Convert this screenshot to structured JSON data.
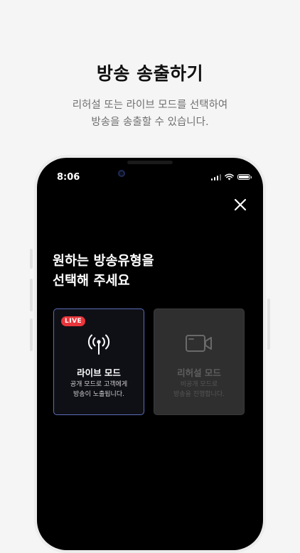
{
  "promo": {
    "title": "방송 송출하기",
    "subtitle_line1": "리허설 또는 라이브 모드를 선택하여",
    "subtitle_line2": "방송을 송출할 수 있습니다."
  },
  "status_bar": {
    "time": "8:06",
    "icons": [
      "cellular-signal-icon",
      "wifi-icon",
      "battery-icon"
    ]
  },
  "screen": {
    "close_icon": "close-icon",
    "heading_line1": "원하는 방송유형을",
    "heading_line2": "선택해 주세요"
  },
  "modes": {
    "live": {
      "badge": "LIVE",
      "icon": "broadcast-antenna-icon",
      "title": "라이브 모드",
      "desc_line1": "공개 모드로 고객에게",
      "desc_line2": "방송이 노출됩니다.",
      "selected": true
    },
    "rehearsal": {
      "icon": "video-camera-icon",
      "title": "리허설 모드",
      "desc_line1": "비공개 모드로",
      "desc_line2": "방송을 진행합니다.",
      "selected": false
    }
  },
  "colors": {
    "live_badge": "#e8353b",
    "selected_border": "#5b6db8",
    "screen_bg": "#000000"
  }
}
